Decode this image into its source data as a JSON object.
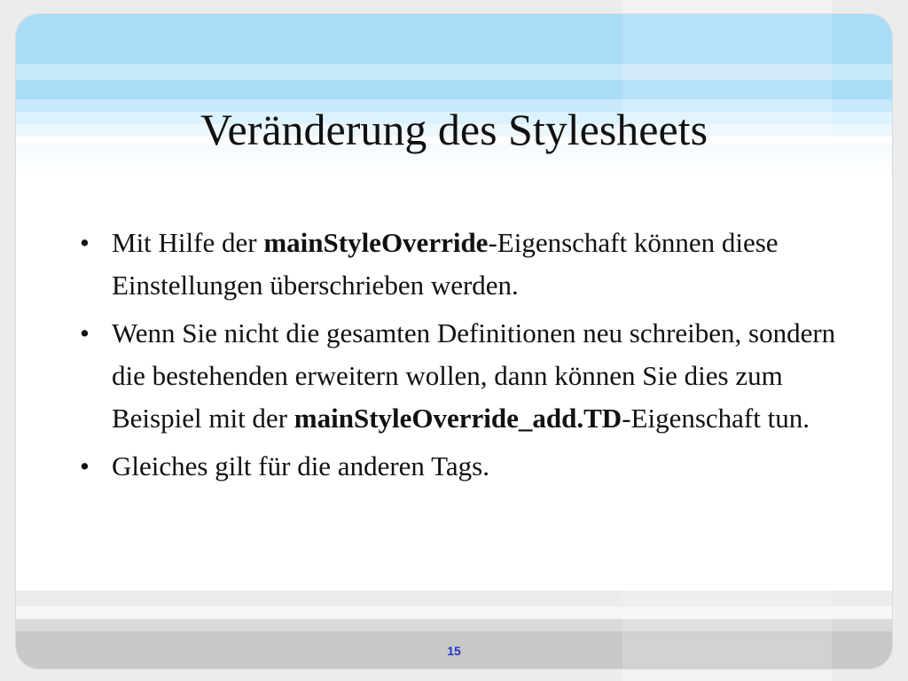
{
  "slide": {
    "title": "Veränderung des Stylesheets",
    "bullets": [
      {
        "parts": [
          {
            "text": "Mit Hilfe der ",
            "bold": false
          },
          {
            "text": "mainStyleOverride",
            "bold": true
          },
          {
            "text": "-Eigenschaft können diese Einstellungen überschrieben werden.",
            "bold": false
          }
        ]
      },
      {
        "parts": [
          {
            "text": "Wenn Sie nicht die gesamten Definitionen neu schreiben, sondern die bestehenden erweitern wollen, dann können Sie dies zum Beispiel mit der ",
            "bold": false
          },
          {
            "text": "mainStyleOverride_add.TD",
            "bold": true
          },
          {
            "text": "-Eigenschaft tun.",
            "bold": false
          }
        ]
      },
      {
        "parts": [
          {
            "text": "Gleiches gilt für die anderen Tags.",
            "bold": false
          }
        ]
      }
    ],
    "bullet_symbol": "•",
    "page_number": "15"
  },
  "colors": {
    "top_band": "#a9dcf7",
    "page_number": "#1f35c8",
    "text": "#111111"
  }
}
